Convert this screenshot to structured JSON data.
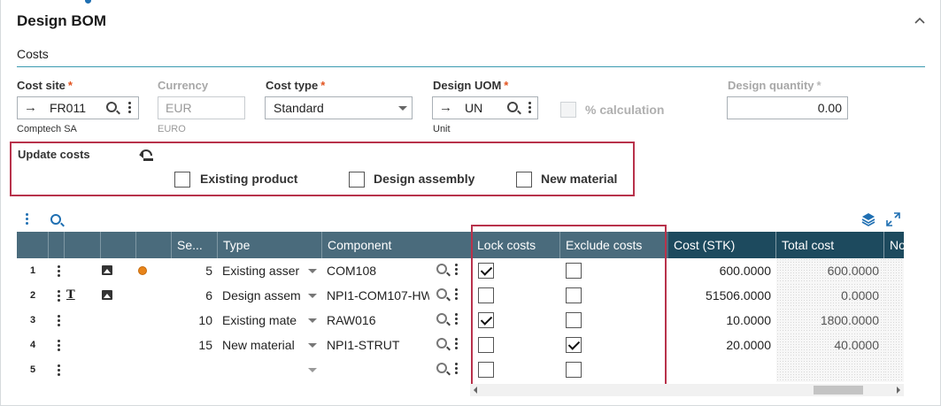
{
  "section": {
    "title": "Design BOM",
    "subtitle": "Costs"
  },
  "fields": {
    "cost_site": {
      "label": "Cost site",
      "value": "FR011",
      "sub": "Comptech SA"
    },
    "currency": {
      "label": "Currency",
      "value": "EUR",
      "sub": "EURO"
    },
    "cost_type": {
      "label": "Cost type",
      "value": "Standard"
    },
    "design_uom": {
      "label": "Design UOM",
      "value": "UN",
      "sub": "Unit"
    },
    "pct_calc": {
      "label": "% calculation"
    },
    "design_quantity": {
      "label": "Design quantity",
      "value": "0.00"
    }
  },
  "update_costs": {
    "label": "Update costs",
    "options": [
      "Existing product",
      "Design assembly",
      "New material"
    ]
  },
  "grid": {
    "columns": [
      "Se...",
      "Type",
      "Component",
      "Lock costs",
      "Exclude costs",
      "Cost (STK)",
      "Total cost",
      "No"
    ],
    "rows": [
      {
        "num": "1",
        "seq": "5",
        "type": "Existing asser",
        "component": "COM108",
        "lock": true,
        "exclude": false,
        "cost": "600.0000",
        "total": "600.0000",
        "has_image": true,
        "has_dot": true,
        "has_t": false
      },
      {
        "num": "2",
        "seq": "6",
        "type": "Design assem",
        "component": "NPI1-COM107-HW",
        "lock": false,
        "exclude": false,
        "cost": "51506.0000",
        "total": "0.0000",
        "has_image": true,
        "has_dot": false,
        "has_t": true
      },
      {
        "num": "3",
        "seq": "10",
        "type": "Existing mate",
        "component": "RAW016",
        "lock": true,
        "exclude": false,
        "cost": "10.0000",
        "total": "1800.0000",
        "has_image": false,
        "has_dot": false,
        "has_t": false
      },
      {
        "num": "4",
        "seq": "15",
        "type": "New material",
        "component": "NPI1-STRUT",
        "lock": false,
        "exclude": true,
        "cost": "20.0000",
        "total": "40.0000",
        "has_image": false,
        "has_dot": false,
        "has_t": false
      },
      {
        "num": "5",
        "seq": "",
        "type": "",
        "component": "",
        "lock": false,
        "exclude": false,
        "cost": "",
        "total": "",
        "has_image": false,
        "has_dot": false,
        "has_t": false
      }
    ],
    "t_glyph": "T"
  },
  "colors": {
    "accent": "#1f6fb2",
    "header_bg": "#4a6b7c",
    "header_dark_bg": "#1d4a5e",
    "highlight_border": "#b8324b",
    "required": "#e2531f",
    "status_dot": "#e8841a"
  },
  "icons": {
    "collapse": "chevron-up-icon",
    "arrow": "arrow-right-icon",
    "search": "search-icon",
    "more": "more-vertical-icon",
    "dropdown": "caret-down-icon",
    "update": "undo-update-icon",
    "layers": "layers-icon",
    "expand": "expand-icon",
    "image": "image-icon",
    "status": "status-dot-icon",
    "text": "text-icon"
  }
}
